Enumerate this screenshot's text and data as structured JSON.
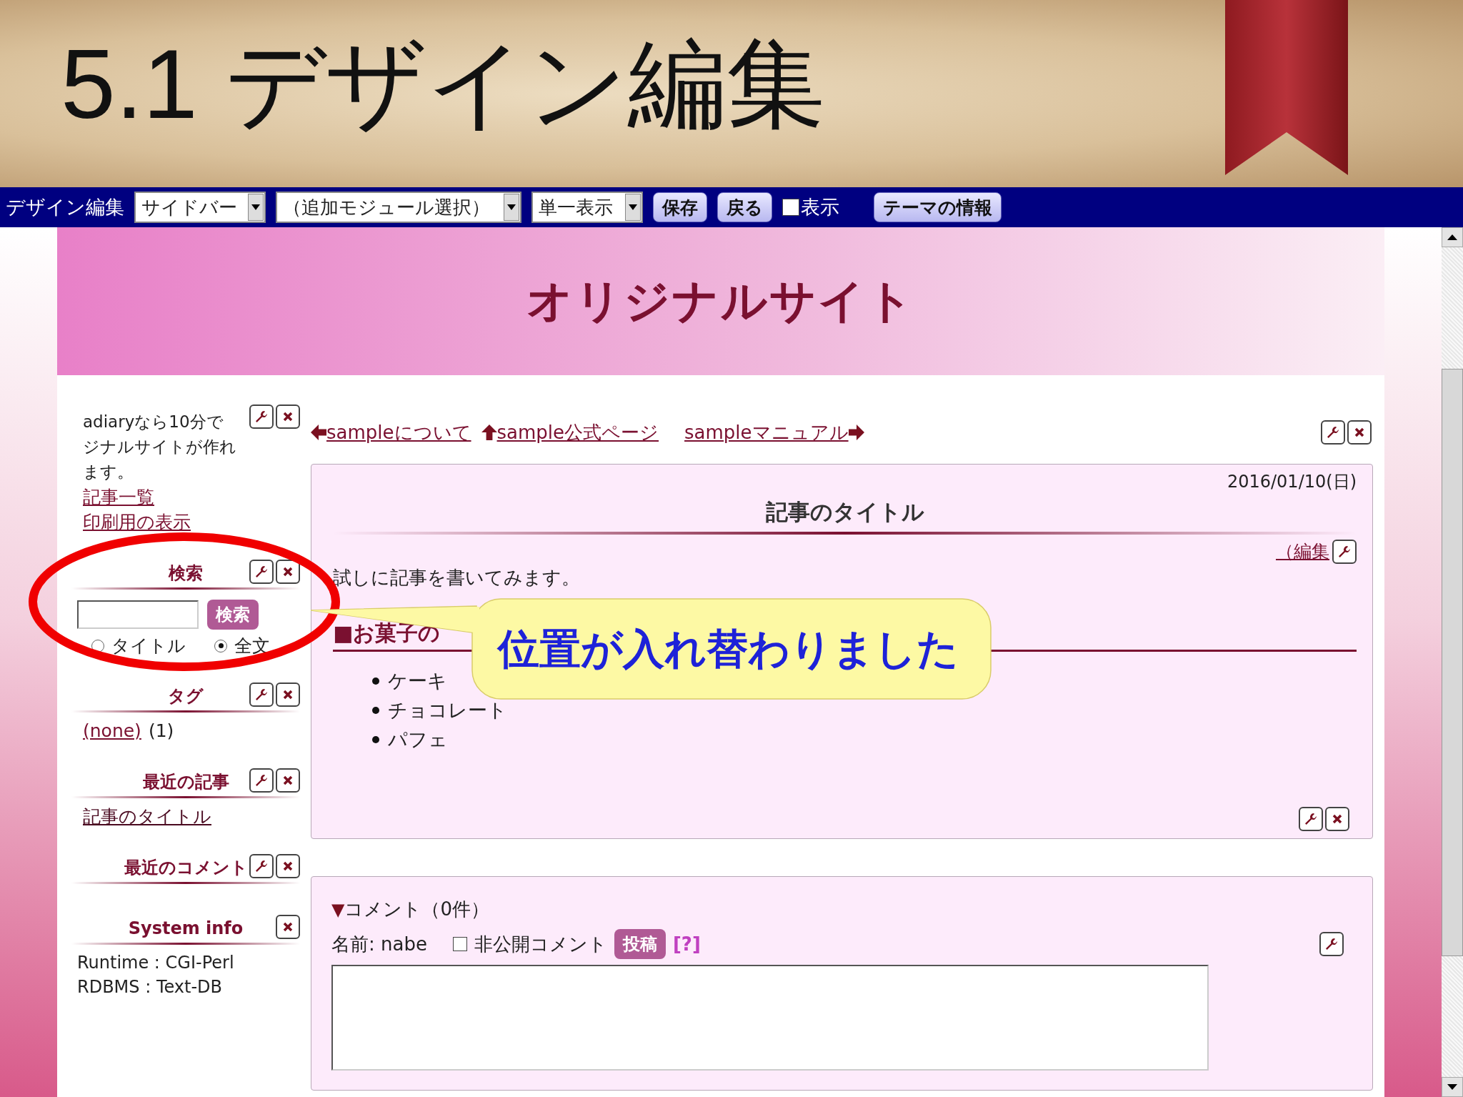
{
  "slide": {
    "title": "5.1 デザイン編集"
  },
  "toolbar": {
    "label": "デザイン編集",
    "selects": [
      "サイドバー",
      "（追加モジュール選択）",
      "単一表示"
    ],
    "buttons": [
      "保存",
      "戻る"
    ],
    "show": {
      "label": "表示",
      "checked": false
    },
    "theme_button": "テーマの情報"
  },
  "site": {
    "title": "オリジナルサイト"
  },
  "sidebar": [
    {
      "kind": "intro",
      "tools": {
        "edit": true,
        "delete": true
      },
      "lines": [
        "adiaryなら10分で",
        "ジナルサイトが作れます。"
      ],
      "links": [
        "記事一覧",
        "印刷用の表示"
      ]
    },
    {
      "kind": "search",
      "title": "検索",
      "tools": {
        "edit": true,
        "delete": true
      },
      "button": "検索",
      "radios": [
        {
          "label": "タイトル",
          "selected": false
        },
        {
          "label": "全文",
          "selected": true
        }
      ]
    },
    {
      "kind": "tags",
      "title": "タグ",
      "tools": {
        "edit": true,
        "delete": true
      },
      "tag": "(none)",
      "count": "(1)"
    },
    {
      "kind": "links",
      "title": "最近の記事",
      "tools": {
        "edit": true,
        "delete": true
      },
      "links": [
        "記事のタイトル"
      ]
    },
    {
      "kind": "links",
      "title": "最近のコメント",
      "tools": {
        "edit": true,
        "delete": true
      }
    },
    {
      "kind": "info",
      "title": "System info",
      "tools": {
        "edit": false,
        "delete": true
      },
      "lines": [
        "Runtime : CGI-Perl",
        "RDBMS : Text-DB"
      ]
    }
  ],
  "main": {
    "nav": [
      {
        "kind": "left",
        "text": "sampleについて"
      },
      {
        "kind": "up",
        "text": "sample公式ページ"
      },
      {
        "kind": "right",
        "text": "sampleマニュアル"
      }
    ],
    "nav_tools": {
      "edit": true,
      "delete": true
    },
    "article": {
      "date": "2016/01/10(日)",
      "title": "記事のタイトル",
      "edit_link": "（編集",
      "edit_tools": {
        "edit": true,
        "delete": false
      },
      "body": "試しに記事を書いてみます。",
      "heading": "■お菓子の",
      "items": [
        "ケーキ",
        "チョコレート",
        "パフェ"
      ],
      "tools": {
        "edit": true,
        "delete": true
      }
    },
    "comments": {
      "toggle": "▼",
      "title": "コメント（0件）",
      "name": "名前: nabe",
      "private": {
        "label": "非公開コメント",
        "checked": false
      },
      "submit": "投稿",
      "help": "[?]",
      "tools": {
        "edit": true,
        "delete": false
      }
    }
  },
  "callout": {
    "text": "位置が入れ替わりました"
  }
}
